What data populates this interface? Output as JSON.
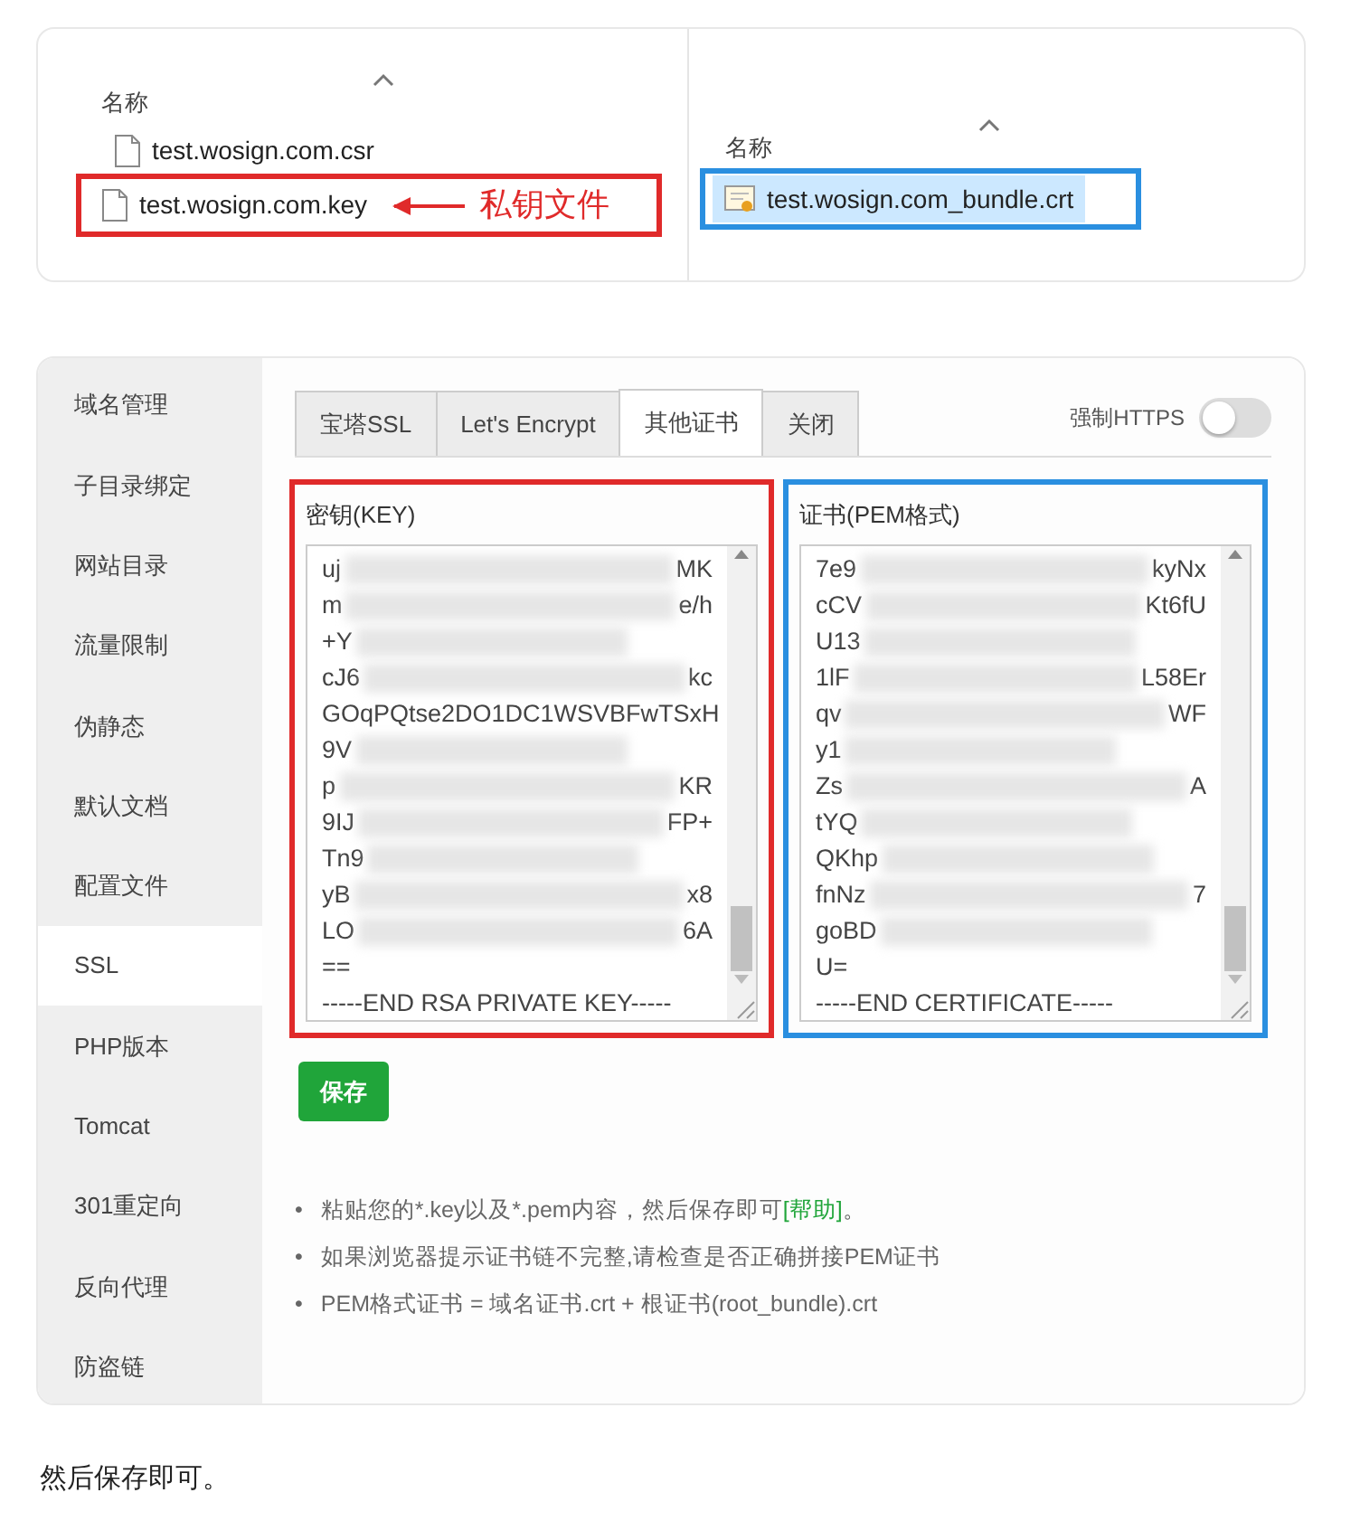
{
  "explorer_left": {
    "column": "名称",
    "files": [
      {
        "name": "test.wosign.com.csr",
        "kind": "file",
        "highlighted": false,
        "selected": false
      },
      {
        "name": "test.wosign.com.key",
        "kind": "file",
        "highlighted": true,
        "selected": false
      }
    ],
    "callout": "私钥文件"
  },
  "explorer_right": {
    "column": "名称",
    "files": [
      {
        "name": "test.wosign.com_bundle.crt",
        "kind": "certificate",
        "highlighted": true,
        "selected": true
      }
    ]
  },
  "panel": {
    "sidebar": [
      {
        "label": "域名管理",
        "selected": false
      },
      {
        "label": "子目录绑定",
        "selected": false
      },
      {
        "label": "网站目录",
        "selected": false
      },
      {
        "label": "流量限制",
        "selected": false
      },
      {
        "label": "伪静态",
        "selected": false
      },
      {
        "label": "默认文档",
        "selected": false
      },
      {
        "label": "配置文件",
        "selected": false
      },
      {
        "label": "SSL",
        "selected": true
      },
      {
        "label": "PHP版本",
        "selected": false
      },
      {
        "label": "Tomcat",
        "selected": false
      },
      {
        "label": "301重定向",
        "selected": false
      },
      {
        "label": "反向代理",
        "selected": false
      },
      {
        "label": "防盗链",
        "selected": false
      }
    ],
    "tabs": [
      {
        "label": "宝塔SSL",
        "selected": false
      },
      {
        "label": "Let's Encrypt",
        "selected": false
      },
      {
        "label": "其他证书",
        "selected": true
      },
      {
        "label": "关闭",
        "selected": false
      }
    ],
    "force_https": {
      "label": "强制HTTPS",
      "on": false
    },
    "fields": [
      {
        "label": "密钥(KEY)",
        "color": "#e02a2a",
        "lines": [
          {
            "text": "uj",
            "redacted": true,
            "end": "MK"
          },
          {
            "text": "m",
            "redacted": true,
            "end": "e/h"
          },
          {
            "text": "+Y",
            "redacted": true
          },
          {
            "text": "cJ6",
            "redacted": true,
            "end": "kc"
          },
          {
            "text": "GOqPQtse2DO1DC1WSVBFwTSxH",
            "redacted": false
          },
          {
            "text": "9V",
            "redacted": true
          },
          {
            "text": "p",
            "redacted": true,
            "end": "KR"
          },
          {
            "text": "9IJ",
            "redacted": true,
            "end": "FP+"
          },
          {
            "text": "Tn9",
            "redacted": true
          },
          {
            "text": "yB",
            "redacted": true,
            "end": "x8"
          },
          {
            "text": "LO",
            "redacted": true,
            "end": "6A"
          },
          {
            "text": "==",
            "redacted": false
          },
          {
            "text": "-----END RSA PRIVATE KEY-----",
            "redacted": false
          }
        ]
      },
      {
        "label": "证书(PEM格式)",
        "color": "#2a8fe0",
        "lines": [
          {
            "text": "7e9",
            "redacted": true,
            "end": "kyNx"
          },
          {
            "text": "cCV",
            "redacted": true,
            "end": "Kt6fU"
          },
          {
            "text": "U13",
            "redacted": true
          },
          {
            "text": "1lF",
            "redacted": true,
            "end": "L58Er"
          },
          {
            "text": "qv",
            "redacted": true,
            "end": "WF"
          },
          {
            "text": "y1",
            "redacted": true
          },
          {
            "text": "Zs",
            "redacted": true,
            "end": "A"
          },
          {
            "text": "tYQ",
            "redacted": true
          },
          {
            "text": "QKhp",
            "redacted": true
          },
          {
            "text": "fnNz",
            "redacted": true,
            "end": "7"
          },
          {
            "text": "goBD",
            "redacted": true
          },
          {
            "text": "U=",
            "redacted": false
          },
          {
            "text": "-----END CERTIFICATE-----",
            "redacted": false
          }
        ]
      }
    ],
    "save_button": "保存",
    "notes": [
      {
        "marker": "•",
        "text": "粘贴您的*.key以及*.pem内容，然后保存即可",
        "link": "[帮助]",
        "after": "。"
      },
      {
        "marker": "•",
        "text": "如果浏览器提示证书链不完整,请检查是否正确拼接PEM证书"
      },
      {
        "marker": "•",
        "text": "PEM格式证书 = 域名证书.crt + 根证书(root_bundle).crt"
      }
    ]
  },
  "caption": "然后保存即可。"
}
